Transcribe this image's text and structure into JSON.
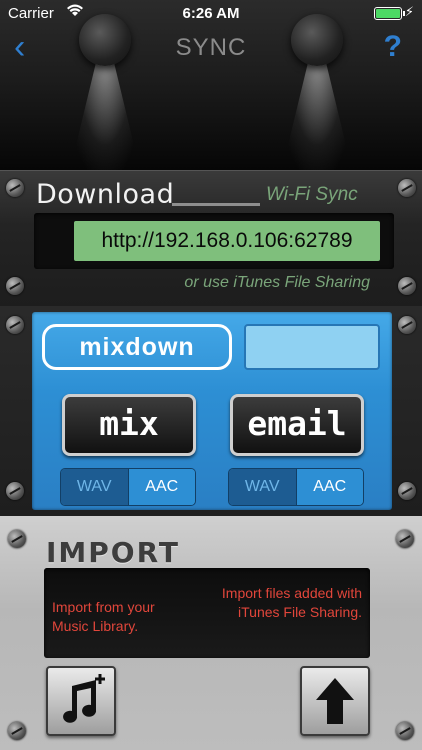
{
  "status": {
    "carrier": "Carrier",
    "time": "6:26 AM"
  },
  "nav": {
    "title": "SYNC",
    "back": "‹",
    "help": "?"
  },
  "download": {
    "title": "Download",
    "wifi_sync": "Wi-Fi Sync",
    "url": "http://192.168.0.106:62789",
    "alt_note": "or use iTunes File Sharing"
  },
  "mixdown": {
    "logo": "mixdown",
    "mix_label": "mix",
    "email_label": "email",
    "mix_formats": [
      "WAV",
      "AAC"
    ],
    "email_formats": [
      "WAV",
      "AAC"
    ]
  },
  "import": {
    "title": "IMPORT",
    "library_note": "Import from your Music Library.",
    "sharing_note": "Import files added with iTunes File Sharing."
  },
  "colors": {
    "accent": "#2f7fd0",
    "panel_blue": "#2d8fd4",
    "url_green": "#7fbf7c",
    "import_red": "#e1463b"
  }
}
